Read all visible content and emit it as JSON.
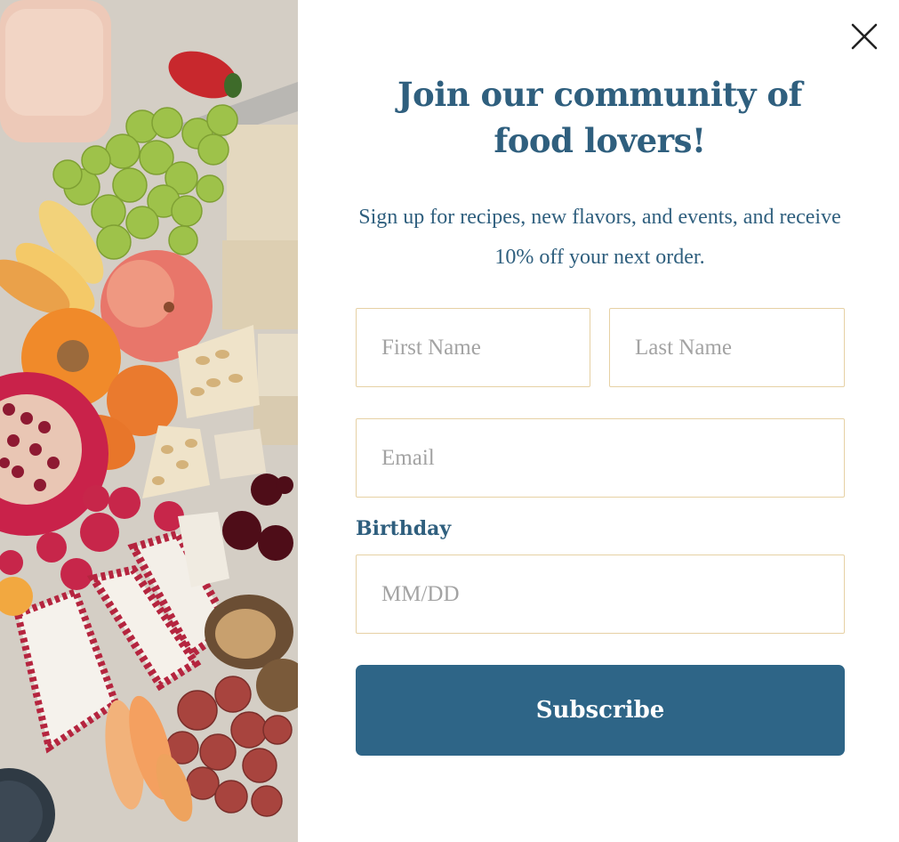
{
  "popup": {
    "headline": "Join our community of food lovers!",
    "subtext": "Sign up for recipes, new flavors, and events, and receive 10% off your next order.",
    "close_icon": "close-icon",
    "image": "food-platter-image"
  },
  "form": {
    "first_name": {
      "placeholder": "First Name",
      "value": ""
    },
    "last_name": {
      "placeholder": "Last Name",
      "value": ""
    },
    "email": {
      "placeholder": "Email",
      "value": ""
    },
    "birthday_label": "Birthday",
    "birthday": {
      "placeholder": "MM/DD",
      "value": ""
    },
    "submit_label": "Subscribe"
  },
  "colors": {
    "accent": "#2f5f7e",
    "button": "#2e6587",
    "field_border": "#e6d1a4",
    "placeholder": "#a3a3a3",
    "background": "#ffffff"
  }
}
